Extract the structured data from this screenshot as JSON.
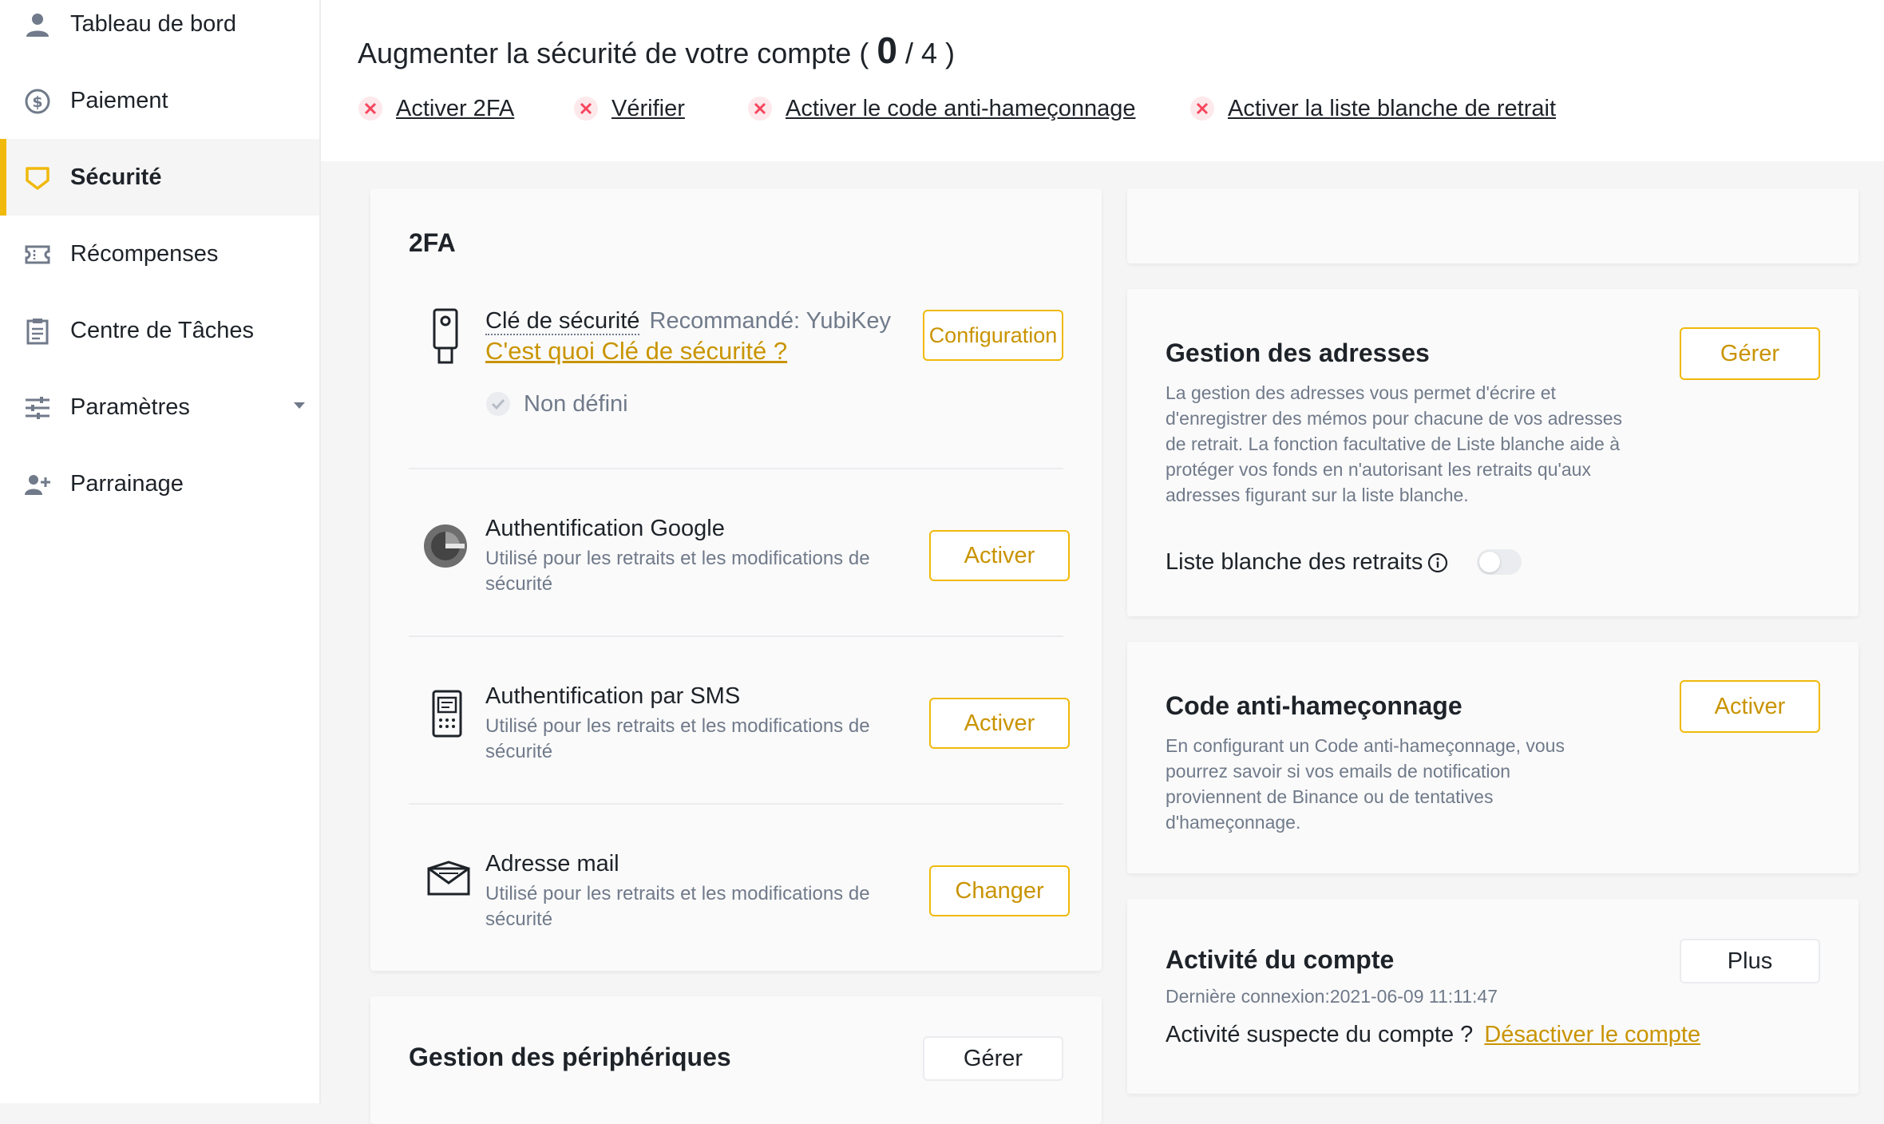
{
  "sidebar": {
    "items": [
      {
        "label": "Tableau de bord",
        "icon": "user-icon"
      },
      {
        "label": "Paiement",
        "icon": "dollar-icon"
      },
      {
        "label": "Sécurité",
        "icon": "shield-icon"
      },
      {
        "label": "Récompenses",
        "icon": "ticket-icon"
      },
      {
        "label": "Centre de Tâches",
        "icon": "clipboard-icon"
      },
      {
        "label": "Paramètres",
        "icon": "sliders-icon"
      },
      {
        "label": "Parrainage",
        "icon": "add-user-icon"
      }
    ],
    "active_index": 2
  },
  "header": {
    "title_prefix": "Augmenter la sécurité de votre compte (",
    "score": "0",
    "score_total": "/ 4 )",
    "requirements": [
      "Activer 2FA",
      "Vérifier",
      "Activer le code anti-hameçonnage",
      "Activer la liste blanche de retrait"
    ]
  },
  "twofa": {
    "title": "2FA",
    "security_key": {
      "title": "Clé de sécurité",
      "recommended": "Recommandé: YubiKey",
      "link": "C'est quoi Clé de sécurité ?",
      "status": "Non défini",
      "button": "Configuration"
    },
    "google": {
      "title": "Authentification Google",
      "desc": "Utilisé pour les retraits et les modifications de sécurité",
      "button": "Activer"
    },
    "sms": {
      "title": "Authentification par SMS",
      "desc": "Utilisé pour les retraits et les modifications de sécurité",
      "button": "Activer"
    },
    "email": {
      "title": "Adresse mail",
      "desc": "Utilisé pour les retraits et les modifications de sécurité",
      "button": "Changer"
    }
  },
  "devices": {
    "title": "Gestion des périphériques",
    "button": "Gérer"
  },
  "address_mgmt": {
    "title": "Gestion des adresses",
    "desc": "La gestion des adresses vous permet d'écrire et d'enregistrer des mémos pour chacune de vos adresses de retrait. La fonction facultative de Liste blanche aide à protéger vos fonds en n'autorisant les retraits qu'aux adresses figurant sur la liste blanche.",
    "whitelist_label": "Liste blanche des retraits",
    "whitelist_enabled": false,
    "button": "Gérer"
  },
  "anti_phishing": {
    "title": "Code anti-hameçonnage",
    "desc": "En configurant un Code anti-hameçonnage, vous pourrez savoir si vos emails de notification proviennent de Binance ou de tentatives d'hameçonnage.",
    "button": "Activer"
  },
  "account_activity": {
    "title": "Activité du compte",
    "last_login": "Dernière connexion:2021-06-09 11:11:47",
    "suspicious_label": "Activité suspecte du compte ?",
    "disable_link": "Désactiver le compte",
    "button": "Plus"
  },
  "colors": {
    "accent": "#f0b90b",
    "accent_text": "#c99400",
    "error": "#f6465d",
    "text": "#1e2329",
    "muted": "#707a8a"
  }
}
